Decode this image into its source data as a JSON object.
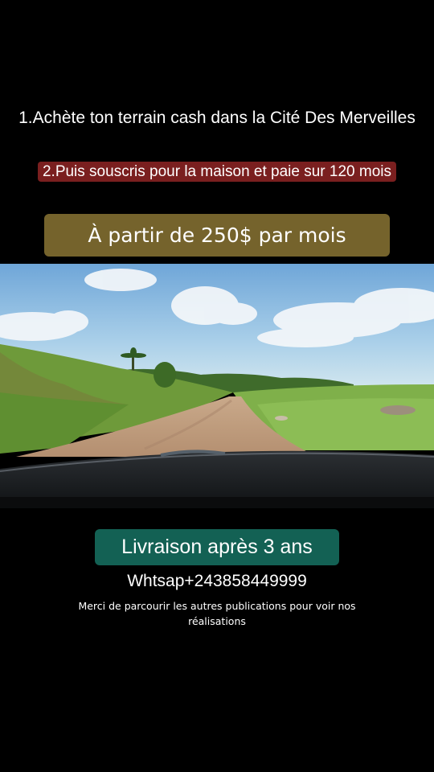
{
  "captions": {
    "line1": "1.Achète ton terrain cash dans la Cité Des Merveilles",
    "line2": "2.Puis souscris pour la maison et paie sur 120 mois",
    "price": "À partir de 250$ par mois",
    "delivery": "Livraison après 3 ans",
    "contact": "Whtsap+243858449999",
    "note": "Merci de parcourir les autres publications pour voir nos réalisations"
  },
  "photo": {
    "scene": "dirt-road-through-green-field-from-car-windshield"
  },
  "colors": {
    "background": "#000000",
    "line2_highlight": "#7a1f1f",
    "price_badge": "#75632c",
    "delivery_badge": "#136154"
  }
}
